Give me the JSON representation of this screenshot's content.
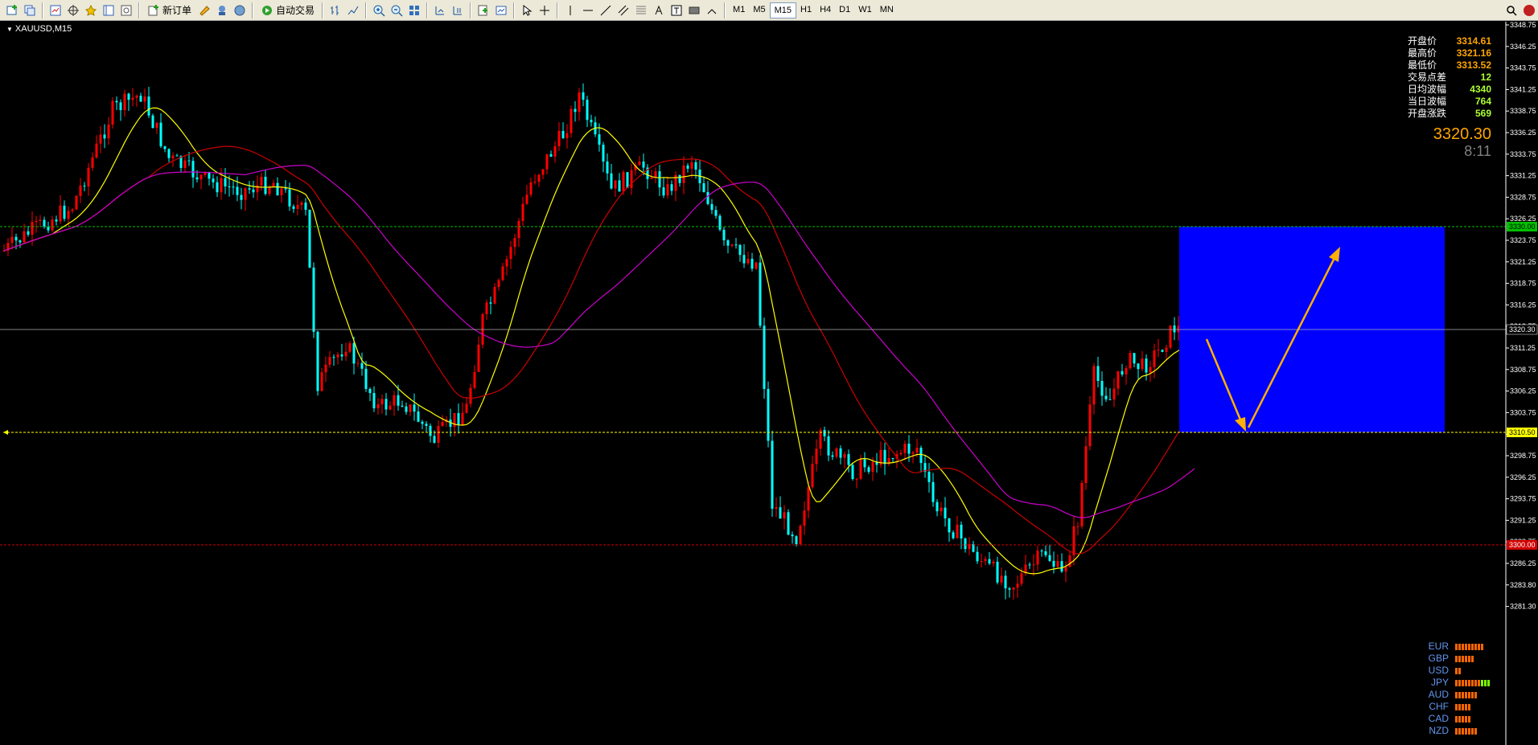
{
  "toolbar": {
    "new_order": "新订单",
    "auto_trade": "自动交易",
    "timeframes": [
      "M1",
      "M5",
      "M15",
      "H1",
      "H4",
      "D1",
      "W1",
      "MN"
    ],
    "active_timeframe": "M15"
  },
  "chart": {
    "symbol": "XAUUSD,M15",
    "bg_color": "#000000",
    "bull_color": "#FF0000",
    "bear_color": "#00FFFF",
    "ma_colors": {
      "fast": "#FFFF00",
      "mid": "#CC0000",
      "slow": "#CC00CC"
    },
    "box_color": "#0000FF",
    "arrow_color": "#FFB000"
  },
  "levels": {
    "upper": "3330.00",
    "current": "3320.30",
    "lower": "3310.50",
    "support": "3300.00"
  },
  "price_axis": [
    "3348.75",
    "3346.25",
    "3343.75",
    "3341.25",
    "3338.75",
    "3336.25",
    "3333.75",
    "3331.25",
    "3328.75",
    "3326.25",
    "3323.75",
    "3321.25",
    "3318.75",
    "3316.25",
    "3313.75",
    "3311.25",
    "3308.75",
    "3306.25",
    "3303.75",
    "3301.25",
    "3298.75",
    "3296.25",
    "3293.75",
    "3291.25",
    "3288.75",
    "3286.25",
    "3283.80",
    "3281.30"
  ],
  "info": [
    {
      "key": "开盘价",
      "value": "3314.61",
      "color": "orange"
    },
    {
      "key": "最高价",
      "value": "3321.16",
      "color": "orange"
    },
    {
      "key": "最低价",
      "value": "3313.52",
      "color": "orange"
    },
    {
      "key": "交易点差",
      "value": "12",
      "color": "green"
    },
    {
      "key": "日均波幅",
      "value": "4340",
      "color": "green"
    },
    {
      "key": "当日波幅",
      "value": "764",
      "color": "green"
    },
    {
      "key": "开盘涨跌",
      "value": "569",
      "color": "green"
    }
  ],
  "price_big": "3320.30",
  "timer": "8:11",
  "strength": [
    {
      "cur": "EUR",
      "n": 9,
      "g": 0
    },
    {
      "cur": "GBP",
      "n": 6,
      "g": 0
    },
    {
      "cur": "USD",
      "n": 2,
      "g": 0
    },
    {
      "cur": "JPY",
      "n": 8,
      "g": 3
    },
    {
      "cur": "AUD",
      "n": 7,
      "g": 0
    },
    {
      "cur": "CHF",
      "n": 5,
      "g": 0
    },
    {
      "cur": "CAD",
      "n": 5,
      "g": 0
    },
    {
      "cur": "NZD",
      "n": 7,
      "g": 0
    }
  ]
}
